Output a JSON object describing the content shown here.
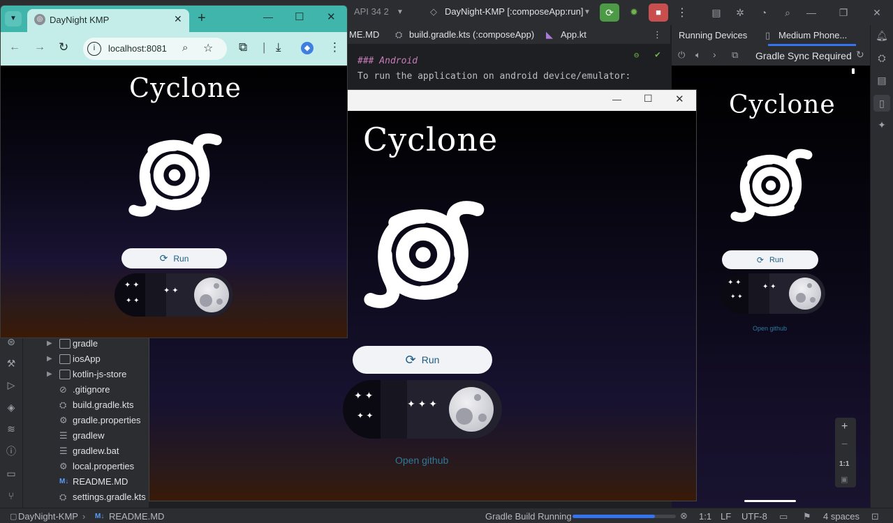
{
  "ide": {
    "device_label": "API 34 2",
    "run_config": "DayNight-KMP [:composeApp:run]",
    "editor_tabs": [
      "ME.MD",
      "build.gradle.kts (:composeApp)",
      "App.kt"
    ],
    "editor_lines": [
      "### Android",
      "To run the application on android device/emulator:"
    ],
    "running_devices_label": "Running Devices",
    "device_tab": "Medium Phone...",
    "gradle_sync": "Gradle Sync Required",
    "zoom_fit_label": "1:1"
  },
  "project_tree": [
    {
      "label": "gradle",
      "type": "folder",
      "expandable": true
    },
    {
      "label": "iosApp",
      "type": "folder",
      "expandable": true
    },
    {
      "label": "kotlin-js-store",
      "type": "folder",
      "expandable": true
    },
    {
      "label": ".gitignore",
      "type": "ignore",
      "expandable": false
    },
    {
      "label": "build.gradle.kts",
      "type": "gradle",
      "expandable": false
    },
    {
      "label": "gradle.properties",
      "type": "settings",
      "expandable": false
    },
    {
      "label": "gradlew",
      "type": "text",
      "expandable": false
    },
    {
      "label": "gradlew.bat",
      "type": "text",
      "expandable": false
    },
    {
      "label": "local.properties",
      "type": "settings",
      "expandable": false
    },
    {
      "label": "README.MD",
      "type": "markdown",
      "expandable": false
    },
    {
      "label": "settings.gradle.kts",
      "type": "gradle",
      "expandable": false
    }
  ],
  "statusbar": {
    "project": "DayNight-KMP",
    "file": "README.MD",
    "build_status": "Gradle Build Running",
    "build_progress": 0.8,
    "position": "1:1",
    "line_sep": "LF",
    "encoding": "UTF-8",
    "indent": "4 spaces"
  },
  "browser": {
    "tab_title": "DayNight KMP",
    "url": "localhost:8081"
  },
  "app": {
    "title": "Cyclone",
    "run_label": "Run",
    "link_label": "Open github"
  },
  "colors": {
    "ide_bg": "#2b2d30",
    "editor_bg": "#1e1f22",
    "browser_accent": "#3fb5ac",
    "run_text": "#1b5e84",
    "link": "#2d7a9c"
  }
}
